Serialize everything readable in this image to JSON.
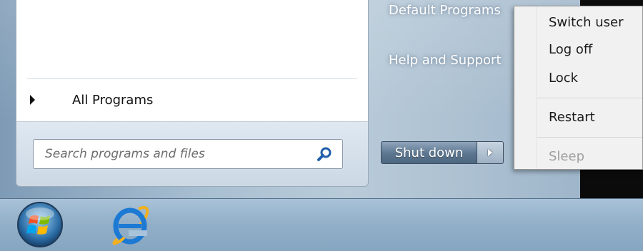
{
  "start_menu": {
    "all_programs_label": "All Programs",
    "search": {
      "placeholder": "Search programs and files",
      "value": ""
    },
    "right_links": [
      "Default Programs",
      "Help and Support"
    ],
    "shutdown_label": "Shut down"
  },
  "power_menu": {
    "items": [
      {
        "label": "Switch user",
        "enabled": true
      },
      {
        "label": "Log off",
        "enabled": true
      },
      {
        "label": "Lock",
        "enabled": true
      },
      {
        "label": "Restart",
        "enabled": true
      },
      {
        "label": "Sleep",
        "enabled": false
      }
    ]
  },
  "taskbar": {
    "icons": [
      "windows-start-orb-icon",
      "internet-explorer-icon"
    ]
  },
  "colors": {
    "taskbar": "#93b0c9",
    "shutdown_button": "#5d7690",
    "menu_background": "#f1f1f1",
    "disabled_text": "#a0a0a0"
  }
}
